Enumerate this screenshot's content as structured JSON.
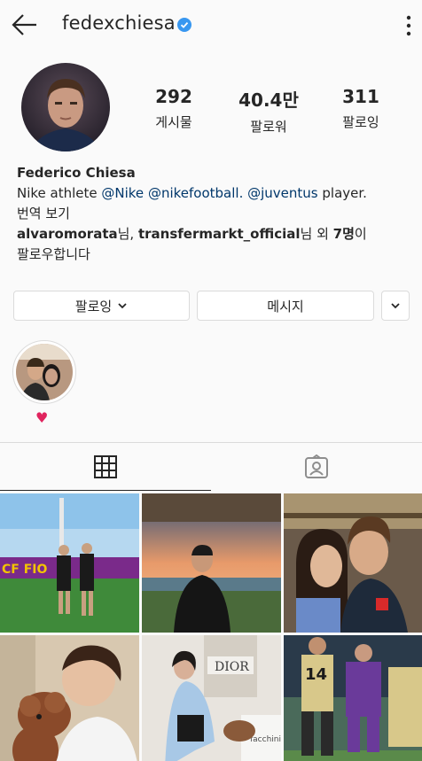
{
  "header": {
    "username": "fedexchiesa"
  },
  "stats": [
    {
      "value": "292",
      "label": "게시물"
    },
    {
      "value": "40.4만",
      "label": "팔로워"
    },
    {
      "value": "311",
      "label": "팔로잉"
    }
  ],
  "bio": {
    "name": "Federico Chiesa",
    "line_prefix": "Nike athlete ",
    "mention1": "@Nike",
    "mention2": "@nikefootball.",
    "mention3": "@juventus",
    "line_suffix": " player.",
    "translate": "번역 보기",
    "follower1": "alvaromorata",
    "follower_sep1": "님, ",
    "follower2": "transfermarkt_official",
    "follower_sep2": "님 외 ",
    "follower_count": "7명",
    "follower_sep3": "이",
    "followed_text": "팔로우합니다"
  },
  "actions": {
    "following_label": "팔로잉",
    "message_label": "메시지"
  },
  "highlight": {
    "label": "♥"
  },
  "tabs": [
    {
      "name": "grid",
      "icon": "grid-icon"
    },
    {
      "name": "tagged",
      "icon": "tagged-person-icon"
    }
  ],
  "colors": {
    "text": "#262626",
    "link": "#00376b",
    "verified": "#3897f0",
    "border": "#dbdbdb",
    "background": "#fafafa"
  }
}
